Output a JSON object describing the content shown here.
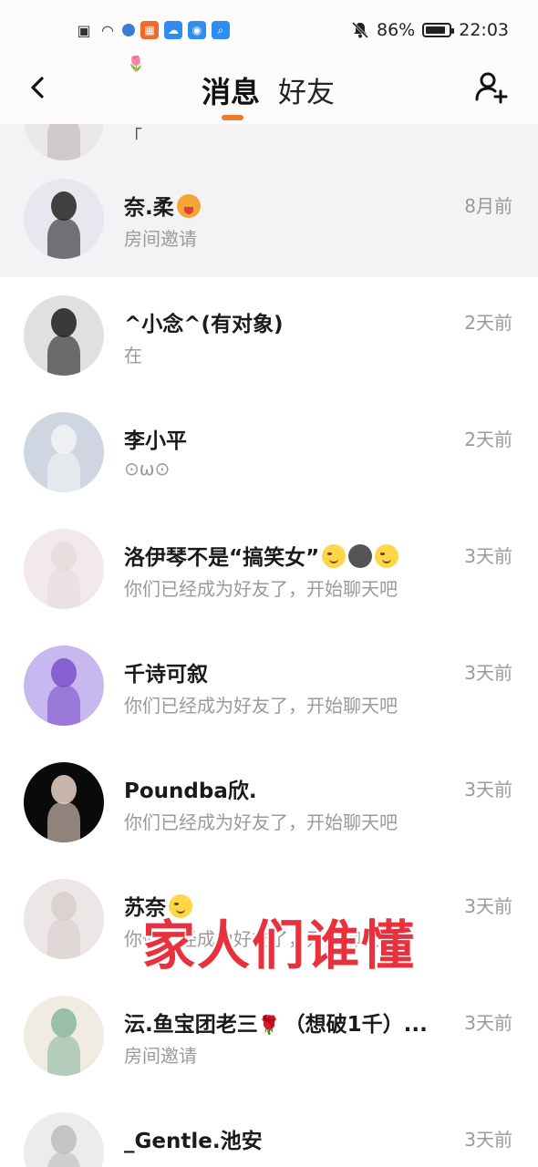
{
  "status_bar": {
    "battery": "86%",
    "battery_level": 0.86,
    "time": "22:03"
  },
  "header": {
    "tab_messages": "消息",
    "tab_friends": "好友"
  },
  "partial_row": {
    "preview": "「"
  },
  "conversations": [
    {
      "name": "奈.柔",
      "preview": "房间邀请",
      "time": "8月前",
      "emoji": "tongue-face-emoji",
      "avatar_colors": [
        "#e9e6ef",
        "#222222"
      ]
    },
    {
      "name": "^小念^(有对象)",
      "preview": "在",
      "time": "2天前",
      "avatar_colors": [
        "#e0e0e0",
        "#1c1c1c"
      ]
    },
    {
      "name": "李小平",
      "preview": "⊙ω⊙",
      "time": "2天前",
      "avatar_colors": [
        "#cfd6e2",
        "#f3f3f5"
      ]
    },
    {
      "name": "洛伊琴不是“搞笑女”",
      "preview": "你们已经成为好友了，开始聊天吧",
      "time": "3天前",
      "emojis": [
        "smirk-emoji",
        "dark-moon-emoji",
        "smirk-emoji"
      ],
      "avatar_colors": [
        "#f1e9ea",
        "#e8dcdc"
      ]
    },
    {
      "name": "千诗可叙",
      "preview": "你们已经成为好友了，开始聊天吧",
      "time": "3天前",
      "avatar_colors": [
        "#c7b9ef",
        "#7b4fc8"
      ]
    },
    {
      "name": "Poundba欣.",
      "preview": "你们已经成为好友了，开始聊天吧",
      "time": "3天前",
      "avatar_colors": [
        "#0a0a0a",
        "#e9d3c6"
      ]
    },
    {
      "name": "苏奈",
      "preview": "你们已经成为好友了，开始聊天吧",
      "time": "3天前",
      "emoji": "smirk-emoji",
      "avatar_colors": [
        "#ece7e6",
        "#d9cfcc"
      ]
    },
    {
      "name": "沄.鱼宝团老三",
      "name_suffix": "（想破1千）...",
      "preview": "房间邀请",
      "time": "3天前",
      "emoji": "rose-emoji",
      "avatar_colors": [
        "#f1ece2",
        "#8ab7a1"
      ]
    },
    {
      "name": "_Gentle.池安",
      "preview": "",
      "time": "3天前",
      "avatar_colors": [
        "#ececec",
        "#bdbdbd"
      ]
    }
  ],
  "overlay_caption": "家人们谁懂"
}
